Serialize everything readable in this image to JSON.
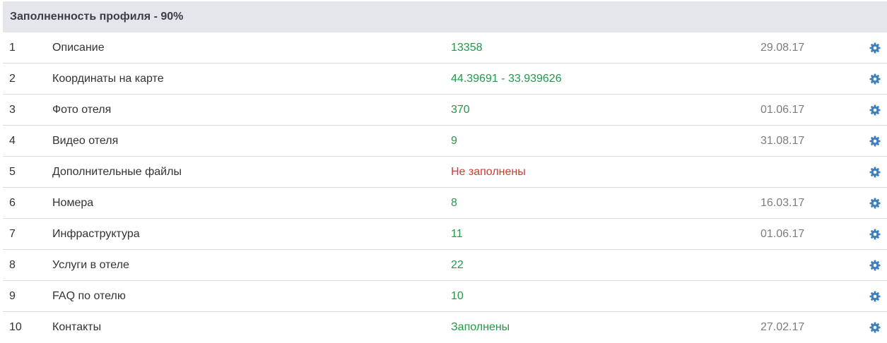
{
  "header": {
    "title": "Заполненность профиля - 90%"
  },
  "colors": {
    "ok": "#1f9a47",
    "bad": "#d33b2f",
    "gear": "#3d7fbf",
    "header_bg": "#e5e6eb"
  },
  "rows": [
    {
      "num": "1",
      "name": "Описание",
      "value": "13358",
      "status": "ok",
      "date": "29.08.17",
      "icon": "gear-icon"
    },
    {
      "num": "2",
      "name": "Координаты на карте",
      "value": "44.39691 - 33.939626",
      "status": "ok",
      "date": "",
      "icon": "gear-icon"
    },
    {
      "num": "3",
      "name": "Фото отеля",
      "value": "370",
      "status": "ok",
      "date": "01.06.17",
      "icon": "gear-icon"
    },
    {
      "num": "4",
      "name": "Видео отеля",
      "value": "9",
      "status": "ok",
      "date": "31.08.17",
      "icon": "gear-icon"
    },
    {
      "num": "5",
      "name": "Дополнительные файлы",
      "value": "Не заполнены",
      "status": "bad",
      "date": "",
      "icon": "gear-icon"
    },
    {
      "num": "6",
      "name": "Номера",
      "value": "8",
      "status": "ok",
      "date": "16.03.17",
      "icon": "gear-icon"
    },
    {
      "num": "7",
      "name": "Инфраструктура",
      "value": "11",
      "status": "ok",
      "date": "01.06.17",
      "icon": "gear-icon"
    },
    {
      "num": "8",
      "name": "Услуги в отеле",
      "value": "22",
      "status": "ok",
      "date": "",
      "icon": "gear-icon"
    },
    {
      "num": "9",
      "name": "FAQ по отелю",
      "value": "10",
      "status": "ok",
      "date": "",
      "icon": "gear-icon"
    },
    {
      "num": "10",
      "name": "Контакты",
      "value": "Заполнены",
      "status": "ok",
      "date": "27.02.17",
      "icon": "gear-icon"
    }
  ]
}
